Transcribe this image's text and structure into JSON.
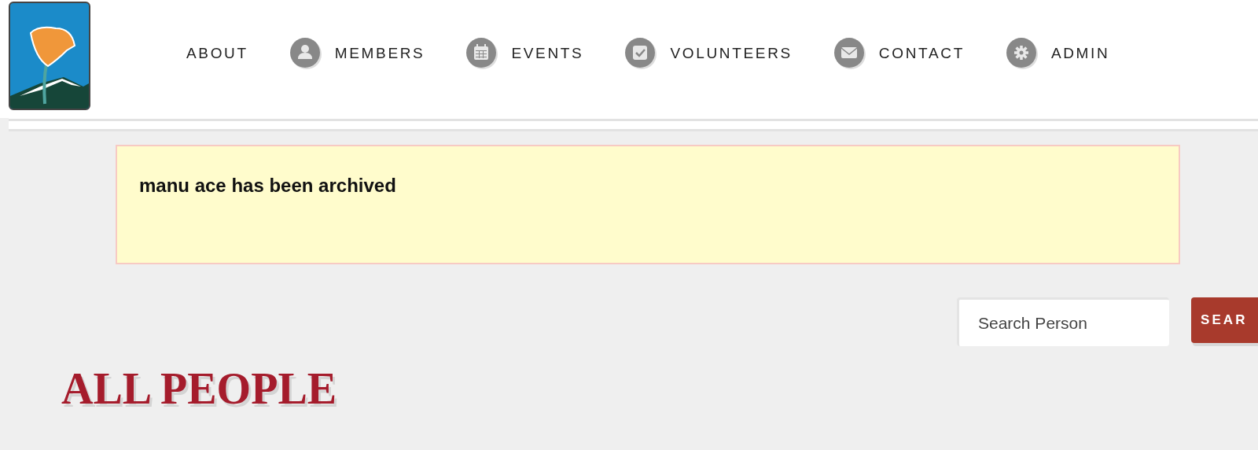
{
  "nav": [
    {
      "label": "ABOUT",
      "kind": "plain"
    },
    {
      "label": "MEMBERS",
      "kind": "icon"
    },
    {
      "label": "EVENTS",
      "kind": "icon"
    },
    {
      "label": "VOLUNTEERS",
      "kind": "icon"
    },
    {
      "label": "CONTACT",
      "kind": "icon"
    },
    {
      "label": "ADMIN",
      "kind": "icon"
    }
  ],
  "alert": {
    "message": "manu ace has been archived"
  },
  "search": {
    "placeholder": "Search Person",
    "button": "SEAR"
  },
  "heading": "ALL PEOPLE"
}
